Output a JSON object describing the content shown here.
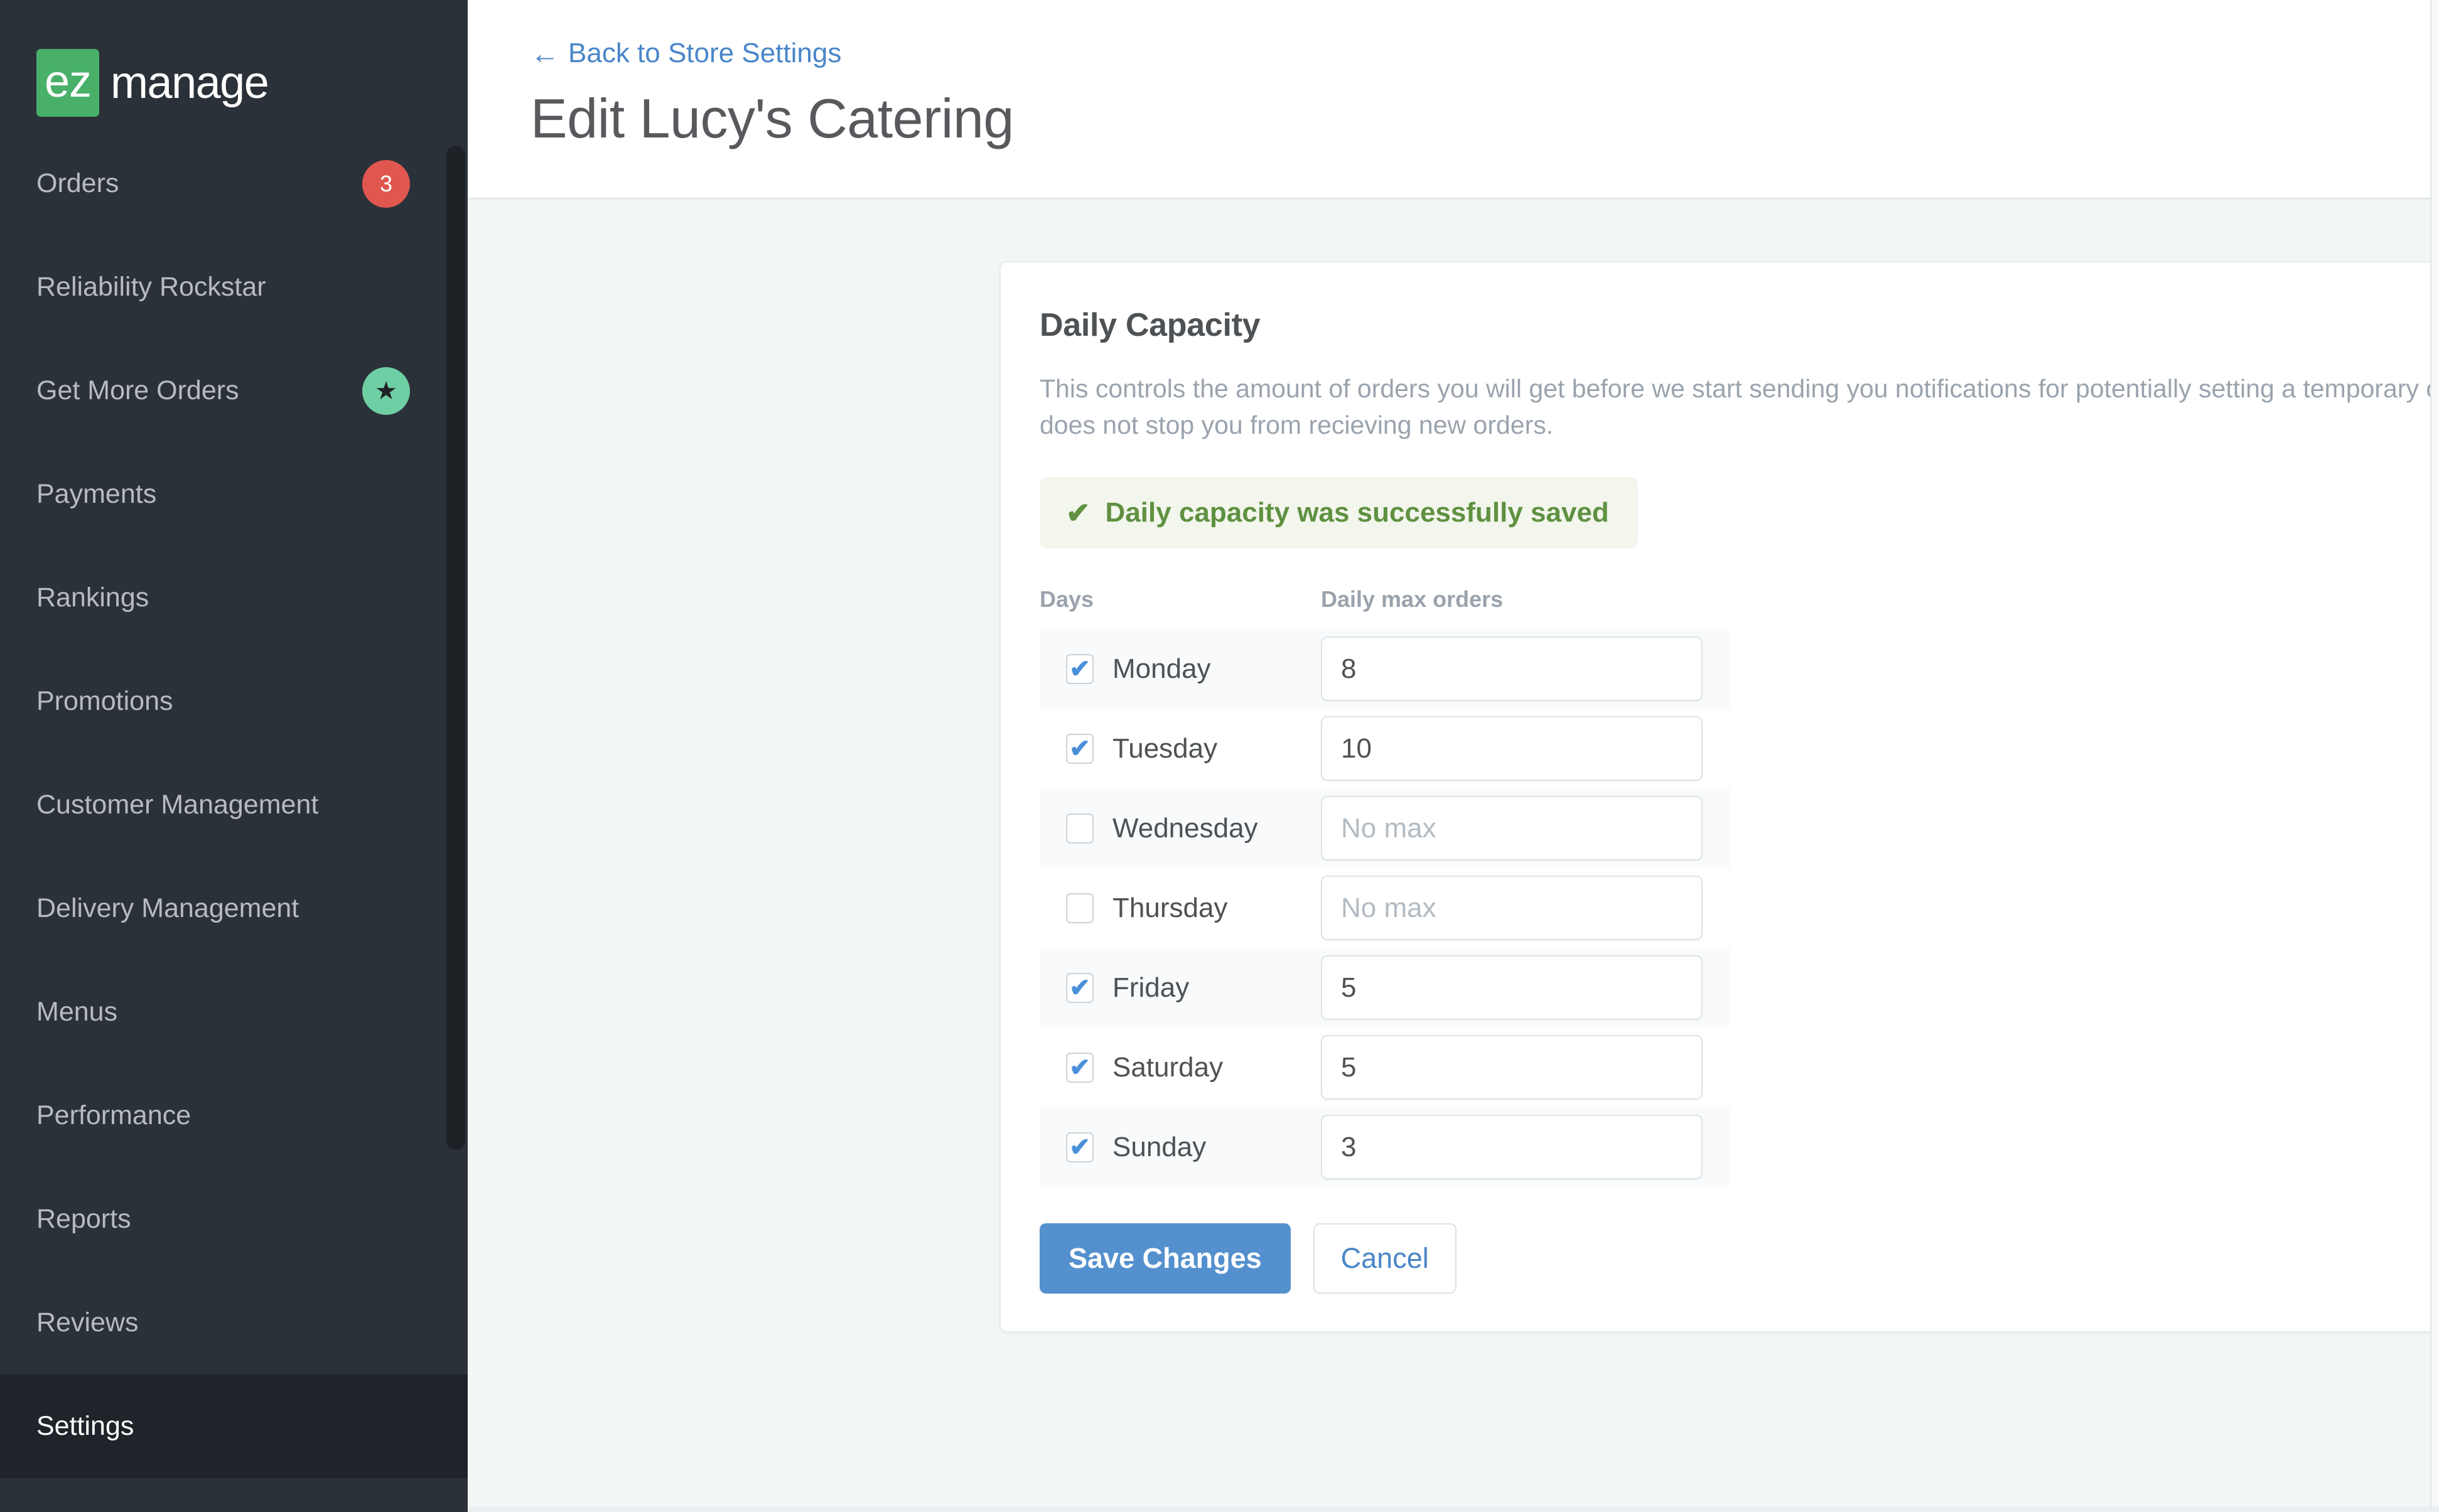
{
  "brand": {
    "logo_mark": "ez",
    "logo_word": "manage",
    "mark_color": "#49b06a"
  },
  "sidebar": {
    "items": [
      {
        "label": "Orders",
        "badge": "3",
        "badge_type": "count",
        "active": false
      },
      {
        "label": "Reliability Rockstar",
        "badge": null,
        "badge_type": null,
        "active": false
      },
      {
        "label": "Get More Orders",
        "badge": "★",
        "badge_type": "star",
        "active": false
      },
      {
        "label": "Payments",
        "badge": null,
        "badge_type": null,
        "active": false
      },
      {
        "label": "Rankings",
        "badge": null,
        "badge_type": null,
        "active": false
      },
      {
        "label": "Promotions",
        "badge": null,
        "badge_type": null,
        "active": false
      },
      {
        "label": "Customer Management",
        "badge": null,
        "badge_type": null,
        "active": false
      },
      {
        "label": "Delivery Management",
        "badge": null,
        "badge_type": null,
        "active": false
      },
      {
        "label": "Menus",
        "badge": null,
        "badge_type": null,
        "active": false
      },
      {
        "label": "Performance",
        "badge": null,
        "badge_type": null,
        "active": false
      },
      {
        "label": "Reports",
        "badge": null,
        "badge_type": null,
        "active": false
      },
      {
        "label": "Reviews",
        "badge": null,
        "badge_type": null,
        "active": false
      },
      {
        "label": "Settings",
        "badge": null,
        "badge_type": null,
        "active": true
      }
    ],
    "badge_count_color": "#e0574f",
    "badge_star_color": "#6fcfa4",
    "background": "#2b3138",
    "active_background": "#20242a"
  },
  "header": {
    "back_link": "Back to Store Settings",
    "back_arrow": "←",
    "title": "Edit Lucy's Catering",
    "link_color": "#4a86c8"
  },
  "card": {
    "title": "Daily Capacity",
    "description": "This controls the amount of orders you will get before we start sending you notifications for potentially setting a temporary closure for your store. This does not stop you from recieving new orders.",
    "alert": {
      "icon": "✔",
      "text": "Daily capacity was successfully saved",
      "text_color": "#5f9141",
      "background": "#f3f6ec"
    },
    "table": {
      "headers": {
        "days": "Days",
        "max_orders": "Daily max orders"
      },
      "rows": [
        {
          "day": "Monday",
          "checked": true,
          "value": "8",
          "placeholder": "No max"
        },
        {
          "day": "Tuesday",
          "checked": true,
          "value": "10",
          "placeholder": "No max"
        },
        {
          "day": "Wednesday",
          "checked": false,
          "value": "",
          "placeholder": "No max"
        },
        {
          "day": "Thursday",
          "checked": false,
          "value": "",
          "placeholder": "No max"
        },
        {
          "day": "Friday",
          "checked": true,
          "value": "5",
          "placeholder": "No max"
        },
        {
          "day": "Saturday",
          "checked": true,
          "value": "5",
          "placeholder": "No max"
        },
        {
          "day": "Sunday",
          "checked": true,
          "value": "3",
          "placeholder": "No max"
        }
      ],
      "check_glyph": "✔"
    },
    "actions": {
      "save_label": "Save Changes",
      "cancel_label": "Cancel",
      "save_color": "#5490ce",
      "cancel_color": "#4a86c8"
    }
  }
}
